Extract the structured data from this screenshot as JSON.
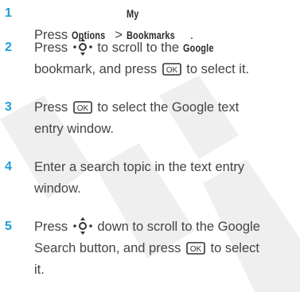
{
  "steps": [
    {
      "number": "1",
      "parts": {
        "a": "Press ",
        "options": "Options",
        "sep": " > ",
        "bookmarks": "My Bookmarks",
        "end": "."
      }
    },
    {
      "number": "2",
      "parts": {
        "a": "Press ",
        "b": " to scroll to the ",
        "google": "Google",
        "c": "bookmark, and press ",
        "d": " to select it."
      }
    },
    {
      "number": "3",
      "parts": {
        "a": "Press ",
        "b": " to select the Google text",
        "c": "entry window."
      }
    },
    {
      "number": "4",
      "parts": {
        "a": "Enter a search topic in the text entry",
        "b": "window."
      }
    },
    {
      "number": "5",
      "parts": {
        "a": "Press ",
        "b": " down to scroll to the Google",
        "c": "Search button, and press ",
        "d": " to select",
        "e": "it."
      }
    }
  ],
  "keys": {
    "ok": "OK"
  },
  "colors": {
    "step_number": "#1f9fd6",
    "body_text": "#444444",
    "watermark": "#ececec"
  },
  "icons": {
    "nav": "navigation-key-icon",
    "ok": "ok-key-icon"
  }
}
